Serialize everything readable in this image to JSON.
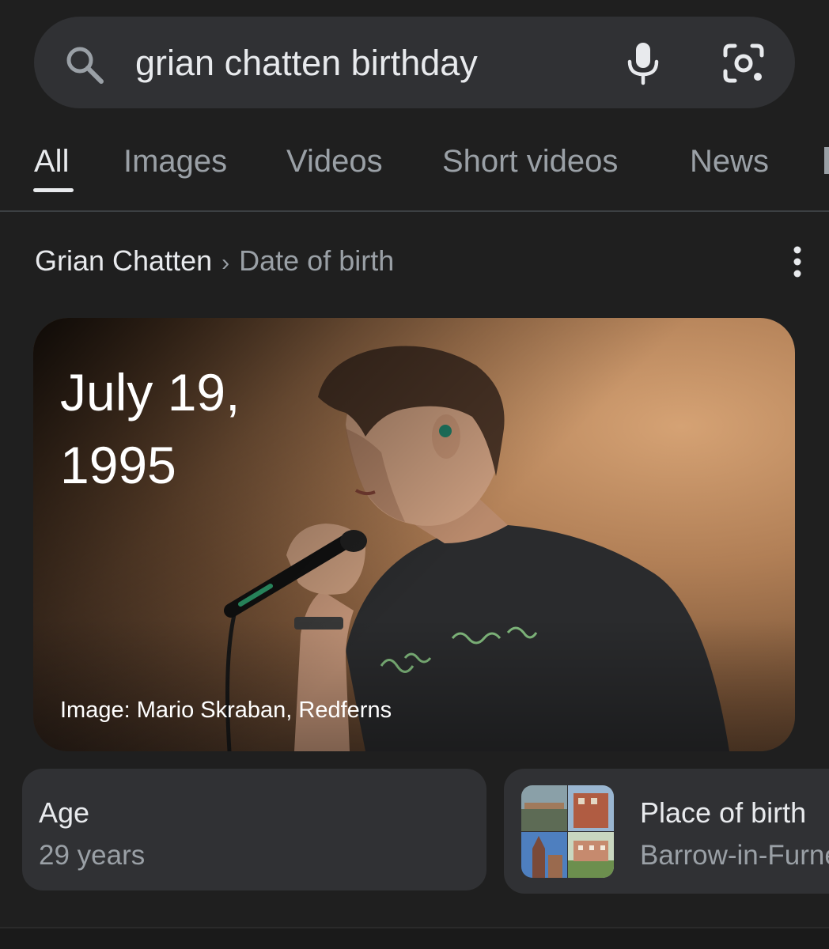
{
  "search": {
    "query": "grian chatten birthday",
    "search_icon": "search-icon",
    "voice_icon": "microphone-icon",
    "lens_icon": "camera-lens-icon"
  },
  "tabs": [
    {
      "label": "All",
      "active": true
    },
    {
      "label": "Images",
      "active": false
    },
    {
      "label": "Videos",
      "active": false
    },
    {
      "label": "Short videos",
      "active": false
    },
    {
      "label": "News",
      "active": false
    }
  ],
  "breadcrumb": {
    "entity": "Grian Chatten",
    "separator": "›",
    "attribute": "Date of birth",
    "menu_icon": "more-vertical-icon"
  },
  "answer": {
    "date_line1": "July 19,",
    "date_line2": "1995",
    "image_credit": "Image: Mario Skraban, Redferns"
  },
  "cards": [
    {
      "title": "Age",
      "subtitle": "29 years"
    },
    {
      "title": "Place of birth",
      "subtitle": "Barrow-in-Furness"
    }
  ],
  "colors": {
    "background": "#1f1f1f",
    "surface": "#303134",
    "text_primary": "#e8eaed",
    "text_secondary": "#9aa0a6"
  }
}
